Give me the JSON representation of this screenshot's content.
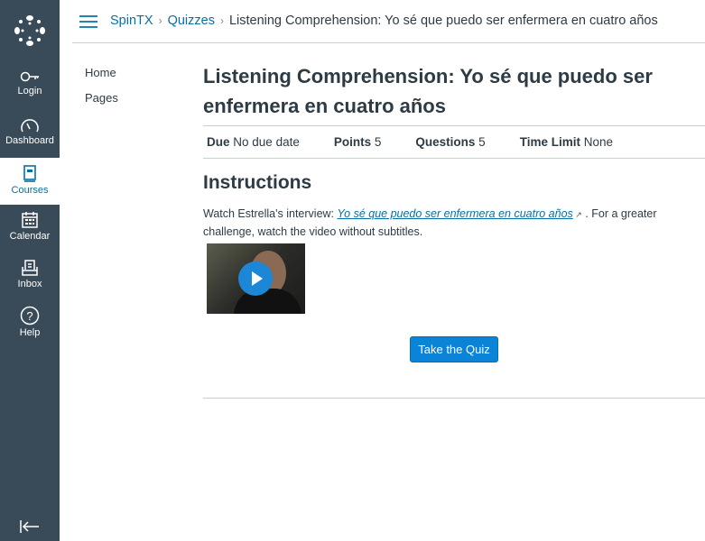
{
  "nav": {
    "items": [
      {
        "label": "Login",
        "icon": "key-icon"
      },
      {
        "label": "Dashboard",
        "icon": "dashboard-icon"
      },
      {
        "label": "Courses",
        "icon": "courses-icon",
        "active": true
      },
      {
        "label": "Calendar",
        "icon": "calendar-icon"
      },
      {
        "label": "Inbox",
        "icon": "inbox-icon"
      },
      {
        "label": "Help",
        "icon": "help-icon"
      }
    ]
  },
  "breadcrumb": {
    "items": [
      "SpinTX",
      "Quizzes"
    ],
    "current": "Listening Comprehension: Yo sé que puedo ser enfermera en cuatro años"
  },
  "course_nav": [
    "Home",
    "Pages"
  ],
  "quiz": {
    "title": "Listening Comprehension: Yo sé que puedo ser enfermera en cuatro años",
    "details": [
      {
        "k": "Due",
        "v": "No due date"
      },
      {
        "k": "Points",
        "v": "5"
      },
      {
        "k": "Questions",
        "v": "5"
      },
      {
        "k": "Time Limit",
        "v": "None"
      }
    ],
    "instructions_heading": "Instructions",
    "text_before": "Watch Estrella's interview: ",
    "link": "Yo sé que puedo ser enfermera en cuatro años",
    "text_after": " . For a greater challenge, watch the video without subtitles.",
    "take_button": "Take the Quiz"
  },
  "colors": {
    "nav_bg": "#394b58",
    "link": "#0770a3",
    "button": "#0b83d6"
  }
}
